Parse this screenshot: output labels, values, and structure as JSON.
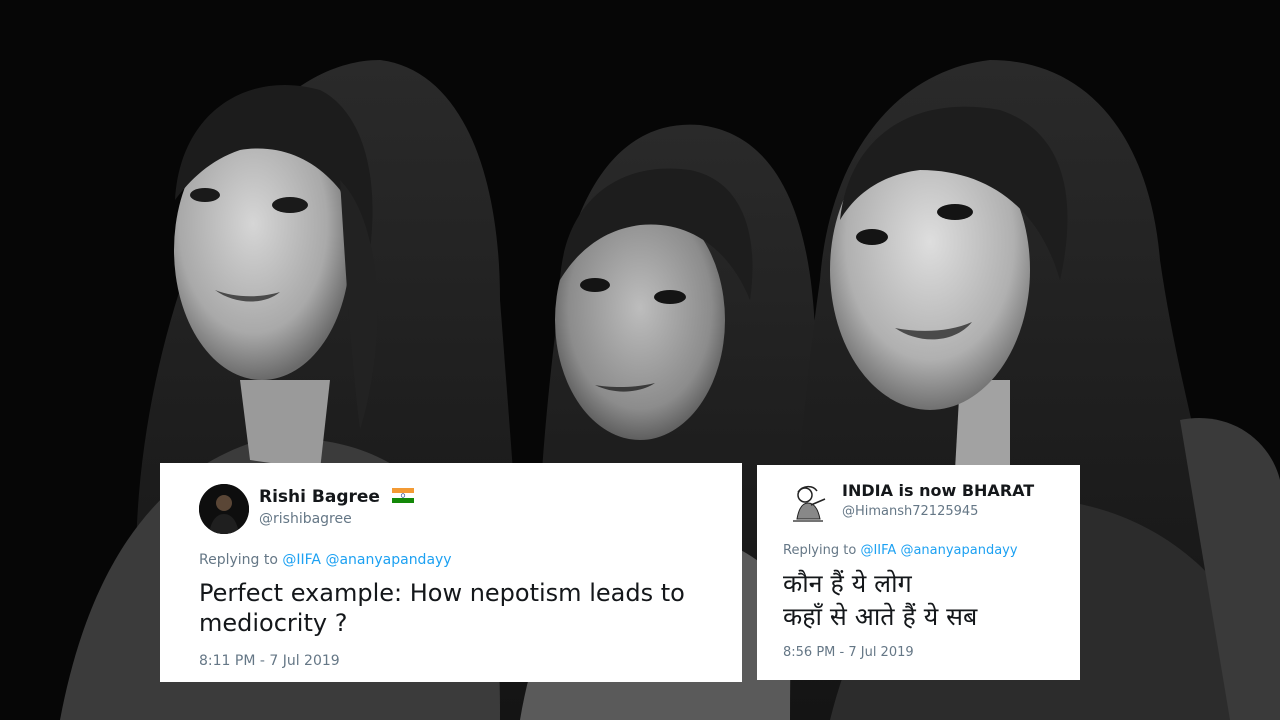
{
  "tweets": [
    {
      "name": "Rishi Bagree",
      "handle": "@rishibagree",
      "replying_prefix": "Replying to",
      "mentions": [
        "@IIFA",
        "@ananyapandayy"
      ],
      "text_lines": [
        "Perfect example: How nepotism leads to",
        "mediocrity ?"
      ],
      "timestamp": "8:11 PM - 7 Jul 2019"
    },
    {
      "name": "INDIA is now BHARAT",
      "handle": "@Himansh72125945",
      "replying_prefix": "Replying to",
      "mentions": [
        "@IIFA",
        "@ananyapandayy"
      ],
      "text_lines": [
        "कौन हैं ये लोग",
        "कहाँ से आते हैं ये सब"
      ],
      "timestamp": "8:56 PM - 7 Jul 2019"
    }
  ],
  "colors": {
    "mention": "#1da1f2",
    "secondary_text": "#657786",
    "primary_text": "#14171a",
    "card_background": "#ffffff"
  }
}
